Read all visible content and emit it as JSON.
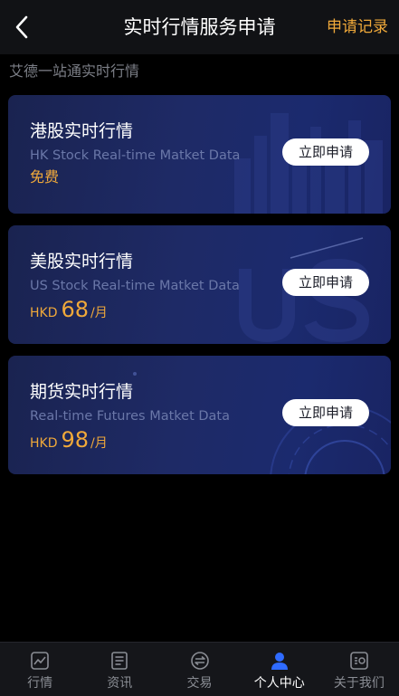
{
  "header": {
    "title": "实时行情服务申请",
    "records_label": "申请记录"
  },
  "subtitle": "艾德一站通实时行情",
  "cards": [
    {
      "title": "港股实时行情",
      "subtitle": "HK Stock Real-time Matket Data",
      "price_text": "免费",
      "button_label": "立即申请"
    },
    {
      "title": "美股实时行情",
      "subtitle": "US Stock Real-time Matket Data",
      "currency": "HKD",
      "price": "68",
      "unit": "/月",
      "button_label": "立即申请"
    },
    {
      "title": "期货实时行情",
      "subtitle": "Real-time Futures Matket Data",
      "currency": "HKD",
      "price": "98",
      "unit": "/月",
      "button_label": "立即申请"
    }
  ],
  "tabbar": {
    "items": [
      {
        "label": "行情",
        "icon": "chart-icon"
      },
      {
        "label": "资讯",
        "icon": "news-icon"
      },
      {
        "label": "交易",
        "icon": "exchange-icon"
      },
      {
        "label": "个人中心",
        "icon": "person-icon",
        "active": true
      },
      {
        "label": "关于我们",
        "icon": "about-icon"
      }
    ]
  },
  "colors": {
    "accent": "#f0a93a",
    "active_tab": "#2f6bff",
    "card_bg": "#1e2a66",
    "background": "#000000"
  }
}
